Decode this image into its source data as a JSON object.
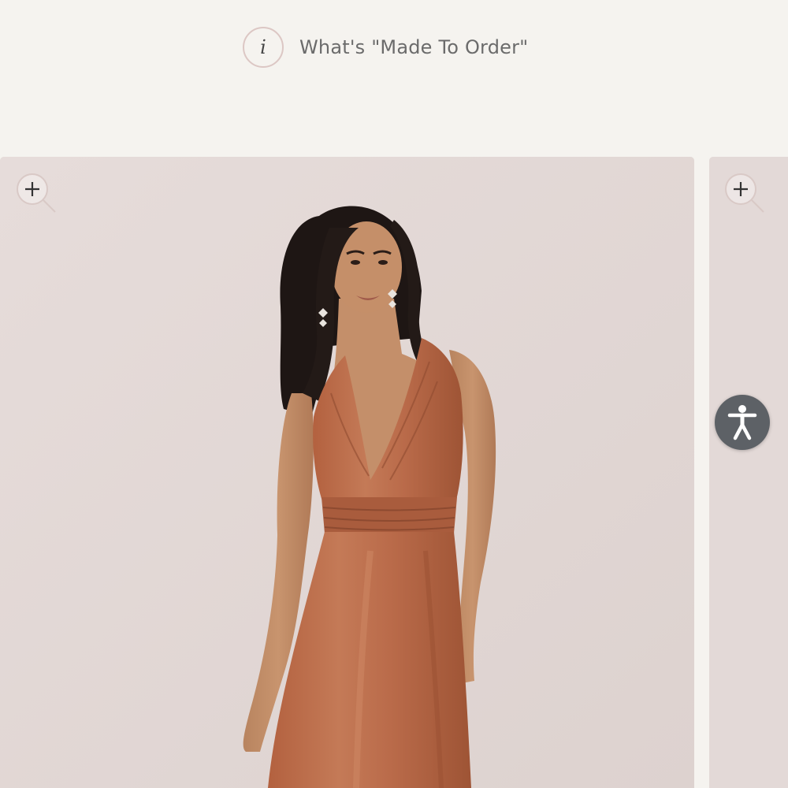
{
  "made_to_order": {
    "info_glyph": "i",
    "label": "What's \"Made To Order\""
  },
  "gallery": {
    "slides": [
      {
        "icon": "zoom-in-icon",
        "image": "model-in-rust-satin-halter-gown"
      },
      {
        "icon": "zoom-in-icon",
        "image": "next-product-photo-partial"
      }
    ]
  },
  "accessibility": {
    "icon": "accessibility-icon"
  },
  "colors": {
    "page_bg": "#f5f3ef",
    "photo_bg": "#e2d8d6",
    "dress": "#b8694a",
    "accent_ring": "#dcc7c4",
    "a11y_button": "#5d6166"
  }
}
